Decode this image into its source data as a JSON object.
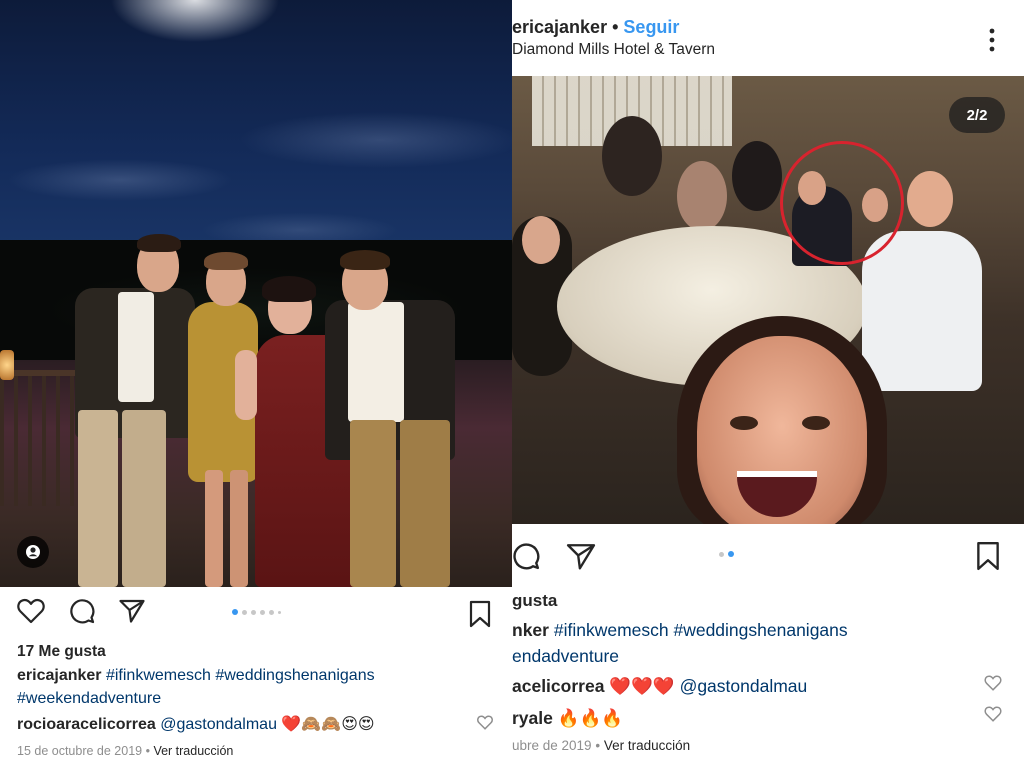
{
  "left_post": {
    "likes": "17 Me gusta",
    "caption_user": "ericajanker",
    "caption_tags_line1": "#ifinkwemesch #weddingshenanigans",
    "caption_tags_line2": "#weekendadventure",
    "comment_user": "rocioaracelicorrea",
    "comment_text": "@gastondalmau",
    "comment_emoji": "❤️🙈🙈😍😍",
    "date": "15 de octubre de 2019",
    "separator": " • ",
    "translate": "Ver traducción",
    "carousel": {
      "total": 6,
      "active": 1
    }
  },
  "right_post": {
    "username": "ericajanker",
    "follow_label": "Seguir",
    "location": "Diamond Mills Hotel & Tavern",
    "counter": "2/2",
    "likes_partial": "gusta",
    "caption_partial_user": "nker",
    "caption_tags_line1": "#ifinkwemesch #weddingshenanigans",
    "caption_tags_line2": "endadventure",
    "comment1_user_partial": "acelicorrea",
    "comment1_emoji": "❤️❤️❤️",
    "comment1_text": "@gastondalmau",
    "comment2_user_partial": "ryale",
    "comment2_emoji": "🔥🔥🔥",
    "date_partial": "ubre de 2019",
    "separator": " • ",
    "translate": "Ver traducción",
    "carousel": {
      "total": 2,
      "active": 2
    }
  },
  "colors": {
    "link_blue": "#3897f0",
    "hashtag": "#00376b",
    "meta_gray": "#8e8e8e",
    "highlight_circle": "#d8232e"
  },
  "icons": [
    "heart-icon",
    "comment-icon",
    "share-icon",
    "bookmark-icon",
    "more-options-icon",
    "user-tag-icon"
  ]
}
